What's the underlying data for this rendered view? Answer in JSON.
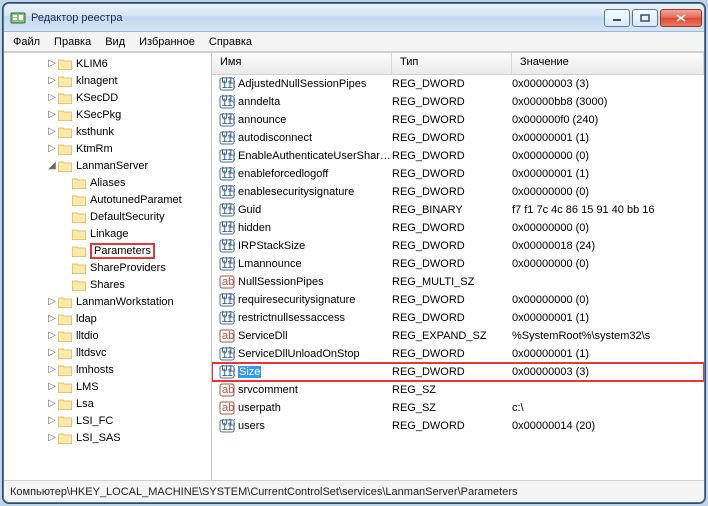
{
  "title": "Редактор реестра",
  "menu": [
    "Файл",
    "Правка",
    "Вид",
    "Избранное",
    "Справка"
  ],
  "columns": {
    "name": "Имя",
    "type": "Тип",
    "data": "Значение"
  },
  "tree": [
    {
      "indent": 3,
      "expand": "▷",
      "label": "KLIM6"
    },
    {
      "indent": 3,
      "expand": "▷",
      "label": "klnagent"
    },
    {
      "indent": 3,
      "expand": "▷",
      "label": "KSecDD"
    },
    {
      "indent": 3,
      "expand": "▷",
      "label": "KSecPkg"
    },
    {
      "indent": 3,
      "expand": "▷",
      "label": "ksthunk"
    },
    {
      "indent": 3,
      "expand": "▷",
      "label": "KtmRm"
    },
    {
      "indent": 3,
      "expand": "◢",
      "label": "LanmanServer"
    },
    {
      "indent": 4,
      "expand": "",
      "label": "Aliases"
    },
    {
      "indent": 4,
      "expand": "",
      "label": "AutotunedParamet"
    },
    {
      "indent": 4,
      "expand": "",
      "label": "DefaultSecurity"
    },
    {
      "indent": 4,
      "expand": "",
      "label": "Linkage"
    },
    {
      "indent": 4,
      "expand": "",
      "label": "Parameters",
      "highlight": true
    },
    {
      "indent": 4,
      "expand": "",
      "label": "ShareProviders"
    },
    {
      "indent": 4,
      "expand": "",
      "label": "Shares"
    },
    {
      "indent": 3,
      "expand": "▷",
      "label": "LanmanWorkstation"
    },
    {
      "indent": 3,
      "expand": "▷",
      "label": "ldap"
    },
    {
      "indent": 3,
      "expand": "▷",
      "label": "lltdio"
    },
    {
      "indent": 3,
      "expand": "▷",
      "label": "lltdsvc"
    },
    {
      "indent": 3,
      "expand": "▷",
      "label": "lmhosts"
    },
    {
      "indent": 3,
      "expand": "▷",
      "label": "LMS"
    },
    {
      "indent": 3,
      "expand": "▷",
      "label": "Lsa"
    },
    {
      "indent": 3,
      "expand": "▷",
      "label": "LSI_FC"
    },
    {
      "indent": 3,
      "expand": "▷",
      "label": "LSI_SAS"
    }
  ],
  "values": [
    {
      "icon": "dword",
      "name": "AdjustedNullSessionPipes",
      "type": "REG_DWORD",
      "data": "0x00000003 (3)"
    },
    {
      "icon": "dword",
      "name": "anndelta",
      "type": "REG_DWORD",
      "data": "0x00000bb8 (3000)"
    },
    {
      "icon": "dword",
      "name": "announce",
      "type": "REG_DWORD",
      "data": "0x000000f0 (240)"
    },
    {
      "icon": "dword",
      "name": "autodisconnect",
      "type": "REG_DWORD",
      "data": "0x00000001 (1)"
    },
    {
      "icon": "dword",
      "name": "EnableAuthenticateUserShar…",
      "type": "REG_DWORD",
      "data": "0x00000000 (0)"
    },
    {
      "icon": "dword",
      "name": "enableforcedlogoff",
      "type": "REG_DWORD",
      "data": "0x00000001 (1)"
    },
    {
      "icon": "dword",
      "name": "enablesecuritysignature",
      "type": "REG_DWORD",
      "data": "0x00000000 (0)"
    },
    {
      "icon": "dword",
      "name": "Guid",
      "type": "REG_BINARY",
      "data": "f7 f1 7c 4c 86 15 91 40 bb 16"
    },
    {
      "icon": "dword",
      "name": "hidden",
      "type": "REG_DWORD",
      "data": "0x00000000 (0)"
    },
    {
      "icon": "dword",
      "name": "IRPStackSize",
      "type": "REG_DWORD",
      "data": "0x00000018 (24)"
    },
    {
      "icon": "dword",
      "name": "Lmannounce",
      "type": "REG_DWORD",
      "data": "0x00000000 (0)"
    },
    {
      "icon": "sz",
      "name": "NullSessionPipes",
      "type": "REG_MULTI_SZ",
      "data": ""
    },
    {
      "icon": "dword",
      "name": "requiresecuritysignature",
      "type": "REG_DWORD",
      "data": "0x00000000 (0)"
    },
    {
      "icon": "dword",
      "name": "restrictnullsessaccess",
      "type": "REG_DWORD",
      "data": "0x00000001 (1)"
    },
    {
      "icon": "sz",
      "name": "ServiceDll",
      "type": "REG_EXPAND_SZ",
      "data": "%SystemRoot%\\system32\\s"
    },
    {
      "icon": "dword",
      "name": "ServiceDllUnloadOnStop",
      "type": "REG_DWORD",
      "data": "0x00000001 (1)"
    },
    {
      "icon": "dword",
      "name": "Size",
      "type": "REG_DWORD",
      "data": "0x00000003 (3)",
      "selected": true,
      "highlight": true
    },
    {
      "icon": "sz",
      "name": "srvcomment",
      "type": "REG_SZ",
      "data": ""
    },
    {
      "icon": "sz",
      "name": "userpath",
      "type": "REG_SZ",
      "data": "c:\\"
    },
    {
      "icon": "dword",
      "name": "users",
      "type": "REG_DWORD",
      "data": "0x00000014 (20)"
    }
  ],
  "statusbar": "Компьютер\\HKEY_LOCAL_MACHINE\\SYSTEM\\CurrentControlSet\\services\\LanmanServer\\Parameters"
}
